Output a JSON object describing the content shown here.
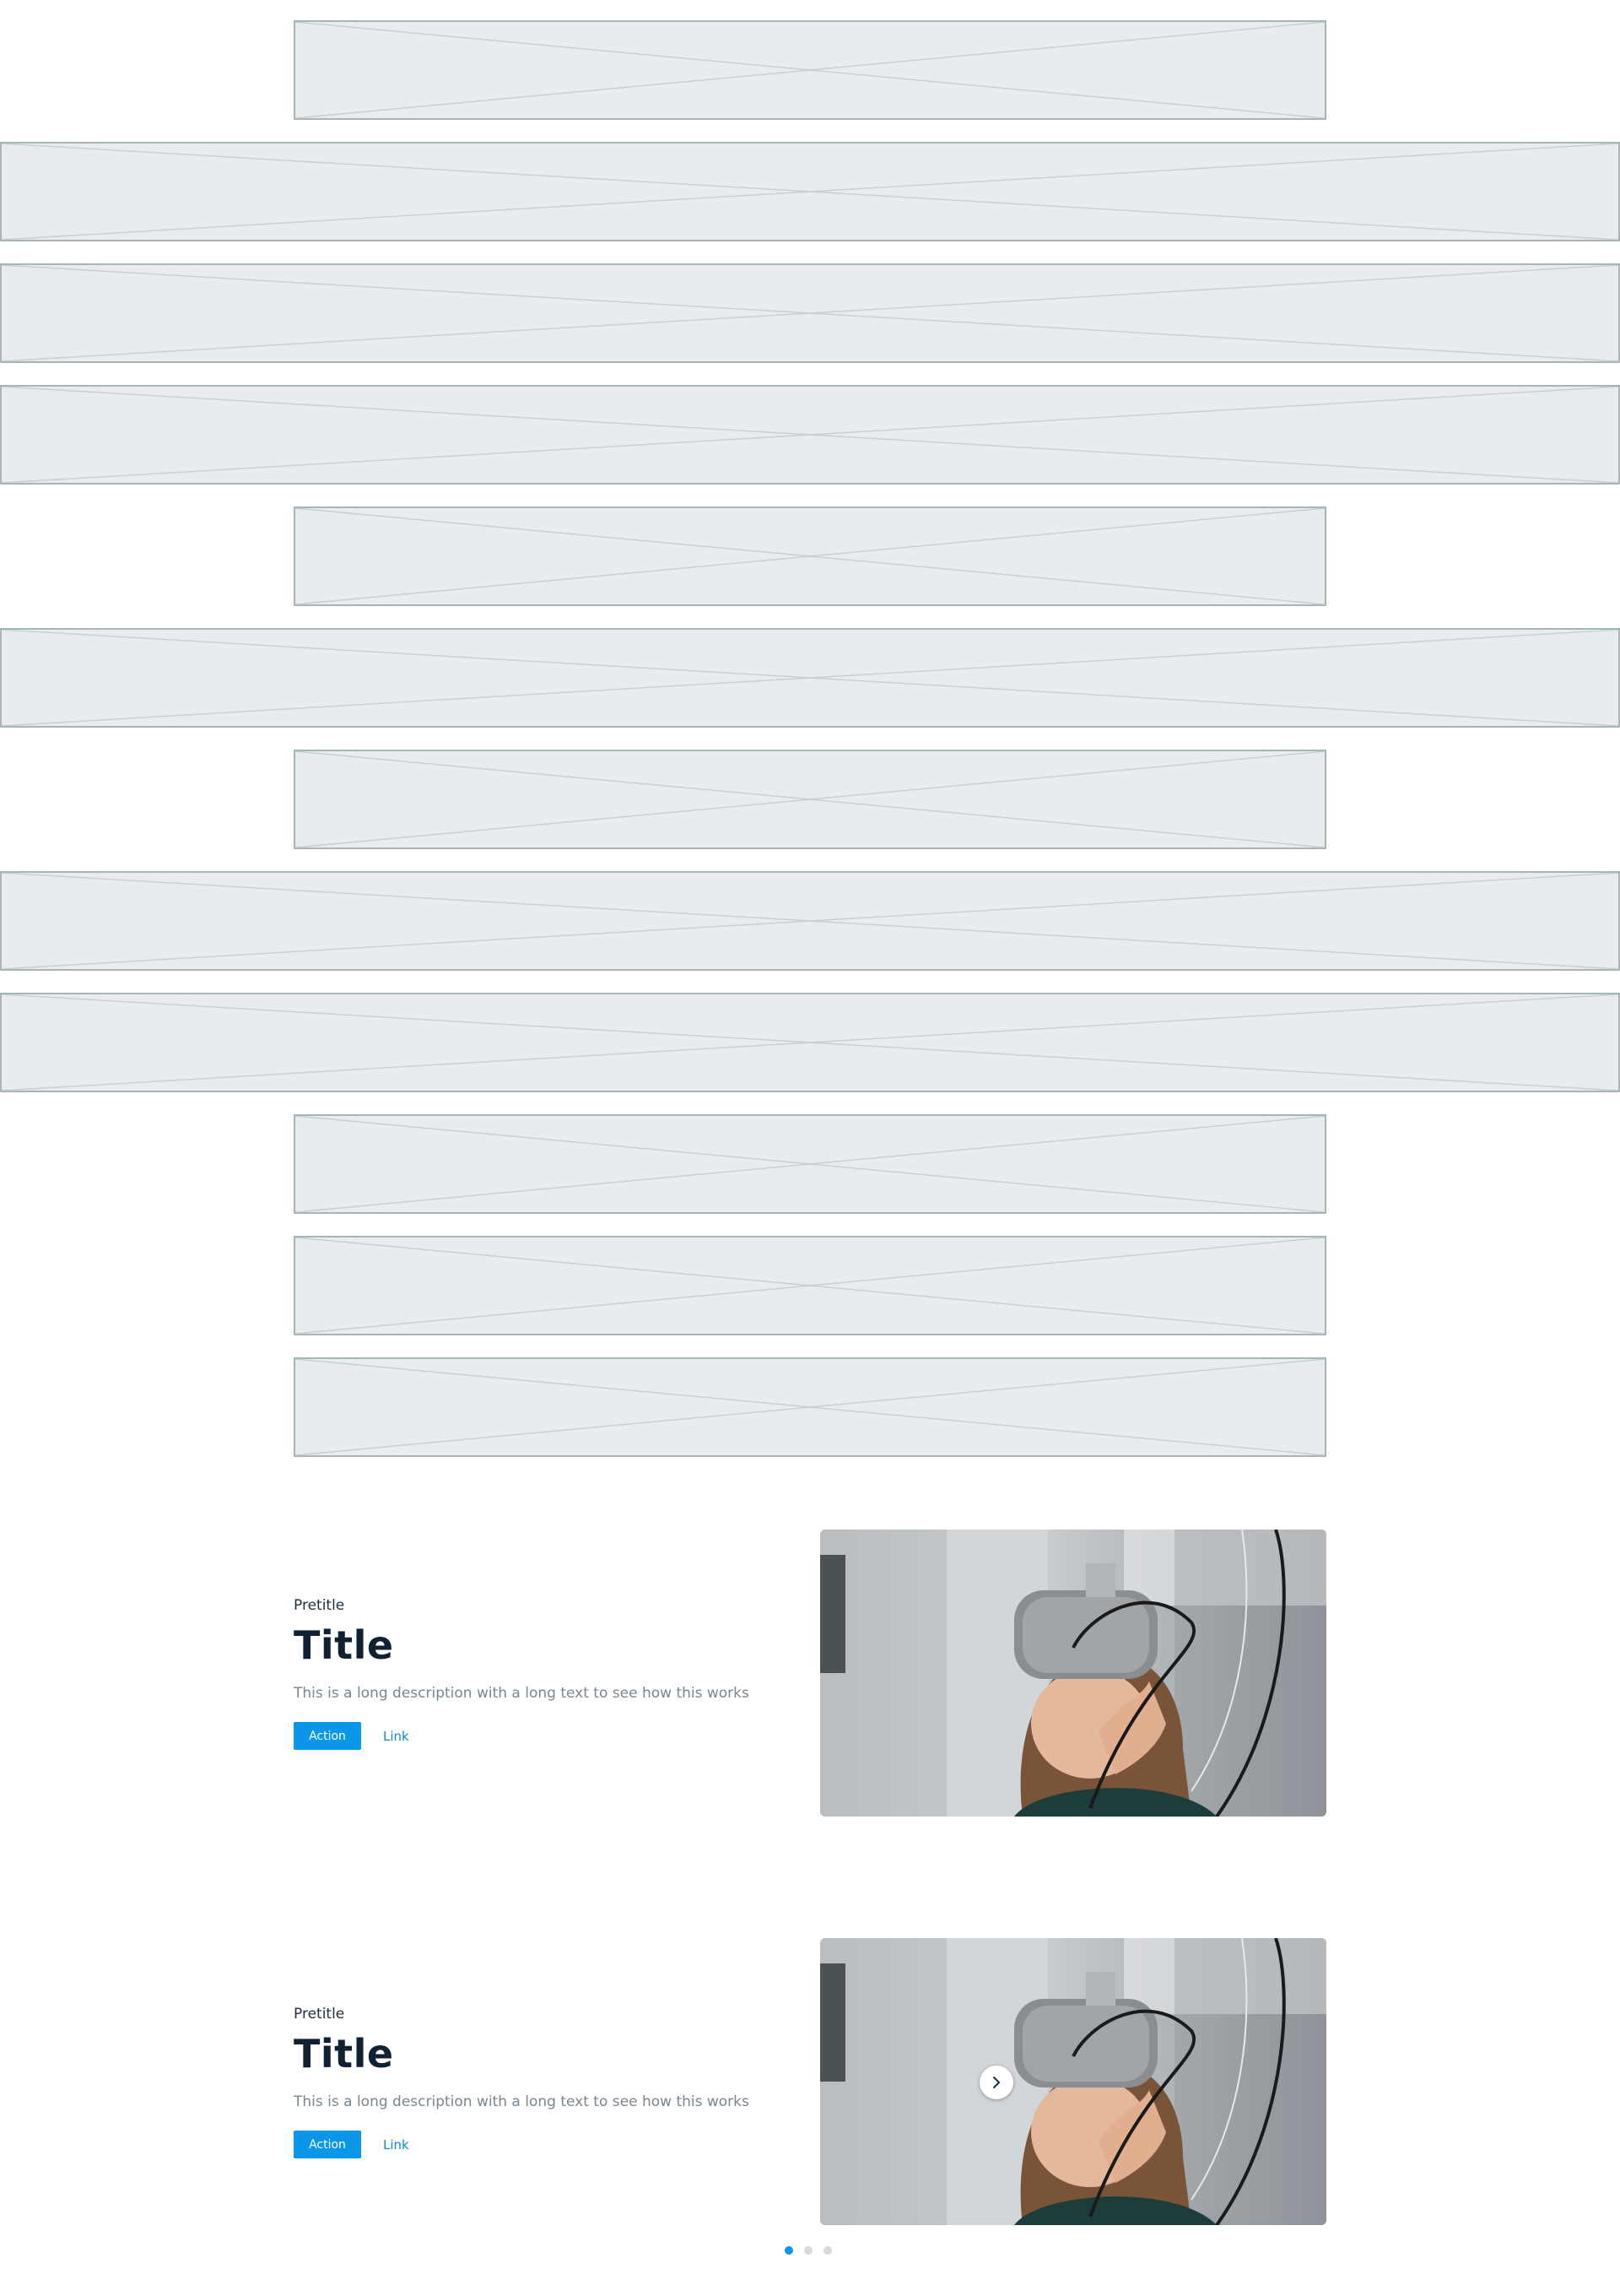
{
  "placeholder_blocks": [
    {
      "width": "contained"
    },
    {
      "width": "full"
    },
    {
      "width": "full"
    },
    {
      "width": "full"
    },
    {
      "width": "contained"
    },
    {
      "width": "full"
    },
    {
      "width": "contained"
    },
    {
      "width": "full"
    },
    {
      "width": "full"
    },
    {
      "width": "contained"
    },
    {
      "width": "contained"
    },
    {
      "width": "contained"
    }
  ],
  "features": [
    {
      "pretitle": "Pretitle",
      "title": "Title",
      "description": "This is a long description with a long text to see how this works",
      "action_label": "Action",
      "link_label": "Link"
    },
    {
      "pretitle": "Pretitle",
      "title": "Title",
      "description": "This is a long description with a long text to see how this works",
      "action_label": "Action",
      "link_label": "Link"
    }
  ],
  "carousel": {
    "next_icon": "chevron-right-icon",
    "page_count": 3,
    "active_page": 1
  },
  "colors": {
    "accent": "#0b97e8",
    "link": "#0b8ad6",
    "title": "#0f2133",
    "muted_text": "#7a858f",
    "placeholder_bg": "#e8ecee",
    "placeholder_border": "#a9b4ba"
  }
}
